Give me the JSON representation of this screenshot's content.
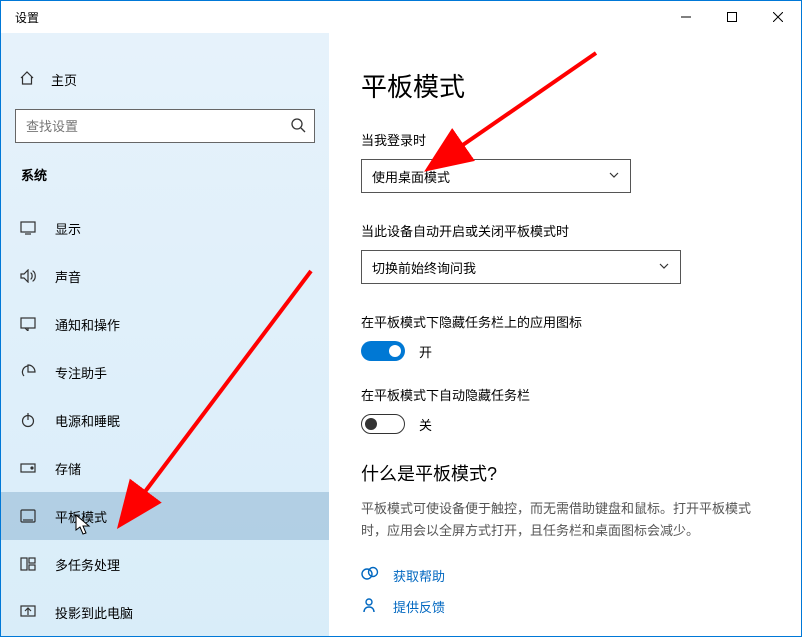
{
  "window": {
    "title": "设置"
  },
  "sidebar": {
    "home_label": "主页",
    "search_placeholder": "查找设置",
    "category_label": "系统",
    "items": [
      {
        "label": "显示",
        "name": "sidebar-item-display"
      },
      {
        "label": "声音",
        "name": "sidebar-item-sound"
      },
      {
        "label": "通知和操作",
        "name": "sidebar-item-notifications"
      },
      {
        "label": "专注助手",
        "name": "sidebar-item-focus-assist"
      },
      {
        "label": "电源和睡眠",
        "name": "sidebar-item-power-sleep"
      },
      {
        "label": "存储",
        "name": "sidebar-item-storage"
      },
      {
        "label": "平板模式",
        "name": "sidebar-item-tablet-mode"
      },
      {
        "label": "多任务处理",
        "name": "sidebar-item-multitasking"
      },
      {
        "label": "投影到此电脑",
        "name": "sidebar-item-projecting"
      }
    ]
  },
  "main": {
    "page_title": "平板模式",
    "signin_label": "当我登录时",
    "signin_value": "使用桌面模式",
    "auto_label": "当此设备自动开启或关闭平板模式时",
    "auto_value": "切换前始终询问我",
    "hide_icons_label": "在平板模式下隐藏任务栏上的应用图标",
    "hide_icons_state": "开",
    "hide_taskbar_label": "在平板模式下自动隐藏任务栏",
    "hide_taskbar_state": "关",
    "what_is_heading": "什么是平板模式?",
    "what_is_body": "平板模式可使设备便于触控，而无需借助键盘和鼠标。打开平板模式时，应用会以全屏方式打开，且任务栏和桌面图标会减少。",
    "help_link": "获取帮助",
    "feedback_link": "提供反馈"
  }
}
